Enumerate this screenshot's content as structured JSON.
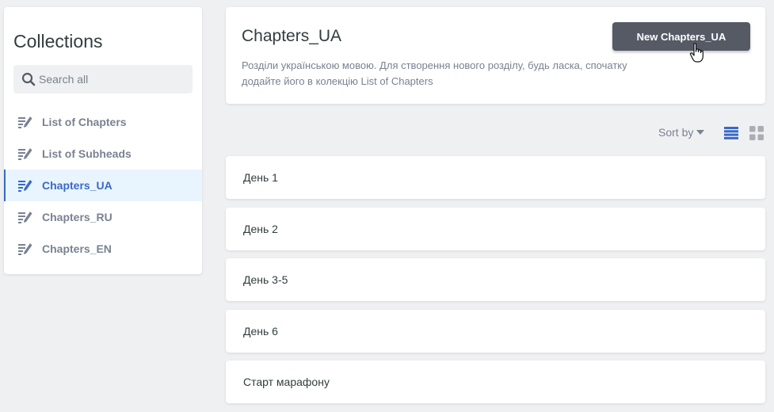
{
  "sidebar": {
    "title": "Collections",
    "search_placeholder": "Search all",
    "items": [
      {
        "label": "List of Chapters",
        "active": false
      },
      {
        "label": "List of Subheads",
        "active": false
      },
      {
        "label": "Chapters_UA",
        "active": true
      },
      {
        "label": "Chapters_RU",
        "active": false
      },
      {
        "label": "Chapters_EN",
        "active": false
      }
    ]
  },
  "header": {
    "title": "Chapters_UA",
    "description": "Розділи українською мовою. Для створення нового розділу, будь ласка, спочатку додайте його в колекцію List of Chapters",
    "new_button_label": "New Chapters_UA"
  },
  "toolbar": {
    "sort_label": "Sort by",
    "view_mode": "list"
  },
  "entries": [
    "День 1",
    "День 2",
    "День 3-5",
    "День 6",
    "Старт марафону"
  ],
  "colors": {
    "background": "#eff0f2",
    "accent": "#3a69c7",
    "active_bg": "#e8f5ff",
    "button": "#555a65",
    "muted_text": "#798291"
  },
  "icons": {
    "search": "search-icon",
    "collection": "collection-edit-icon",
    "sort": "caret-down-icon",
    "list_view": "list-view-icon",
    "grid_view": "grid-view-icon",
    "cursor": "hand-pointer-icon"
  }
}
